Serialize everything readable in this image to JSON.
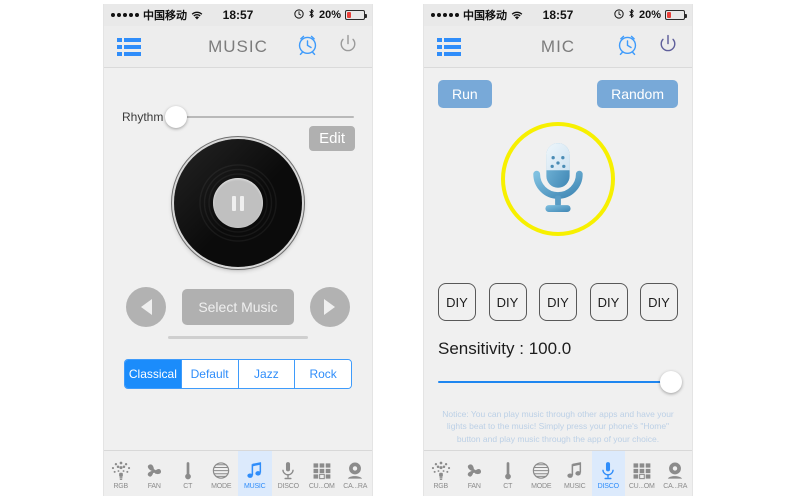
{
  "status_bar": {
    "signal_dots": 5,
    "carrier": "中国移动",
    "wifi_icon": "wifi-icon",
    "time": "18:57",
    "alarm_icon": "alarm-indicator-icon",
    "bluetooth_icon": "bluetooth-icon",
    "battery_percent": "20%",
    "battery_level": 20
  },
  "left_phone": {
    "nav": {
      "menu_icon": "hamburger-menu-icon",
      "title": "MUSIC",
      "timer_icon": "alarm-clock-icon",
      "power_icon": "power-icon"
    },
    "rhythm": {
      "label": "Rhythm",
      "value": 0
    },
    "edit_button": "Edit",
    "record": {
      "play_state_icon": "pause-icon"
    },
    "transport": {
      "prev_icon": "previous-track-icon",
      "select_music_label": "Select Music",
      "next_icon": "next-track-icon"
    },
    "genres": [
      {
        "label": "Classical",
        "active": true
      },
      {
        "label": "Default",
        "active": false
      },
      {
        "label": "Jazz",
        "active": false
      },
      {
        "label": "Rock",
        "active": false
      }
    ]
  },
  "right_phone": {
    "nav": {
      "menu_icon": "hamburger-menu-icon",
      "title": "MIC",
      "timer_icon": "alarm-clock-icon",
      "power_icon": "power-icon"
    },
    "run_button": "Run",
    "random_button": "Random",
    "mic_icon": "microphone-icon",
    "mic_ring_color": "#f7f000",
    "diy_buttons": [
      "DIY",
      "DIY",
      "DIY",
      "DIY",
      "DIY"
    ],
    "sensitivity": {
      "label": "Sensitivity : 100.0",
      "value": 100.0
    },
    "notice": "Notice: You can play music through other apps and have your lights beat to the music! Simply press your phone's \"Home\" button and play music through the app of your choice."
  },
  "tabbar": {
    "items": [
      {
        "label": "RGB",
        "icon": "rgb-bulb-icon",
        "active": false
      },
      {
        "label": "FAN",
        "icon": "fan-icon",
        "active": false
      },
      {
        "label": "CT",
        "icon": "thermometer-icon",
        "active": false
      },
      {
        "label": "MODE",
        "icon": "mode-sphere-icon",
        "active": false
      },
      {
        "label": "MUSIC",
        "icon": "music-note-icon",
        "active": false
      },
      {
        "label": "DISCO",
        "icon": "microphone-icon",
        "active": false
      },
      {
        "label": "CU...OM",
        "icon": "grid-custom-icon",
        "active": false
      },
      {
        "label": "CA...RA",
        "icon": "camera-icon",
        "active": false
      }
    ],
    "left_active_index": 4,
    "right_active_index": 5
  },
  "colors": {
    "accent_blue": "#2f8dfa",
    "button_blue": "#78a9d8",
    "slider_blue": "#1e86f0",
    "ring_yellow": "#f7f000",
    "battery_red": "#e8403a",
    "gray_button": "#b0b0b0"
  }
}
